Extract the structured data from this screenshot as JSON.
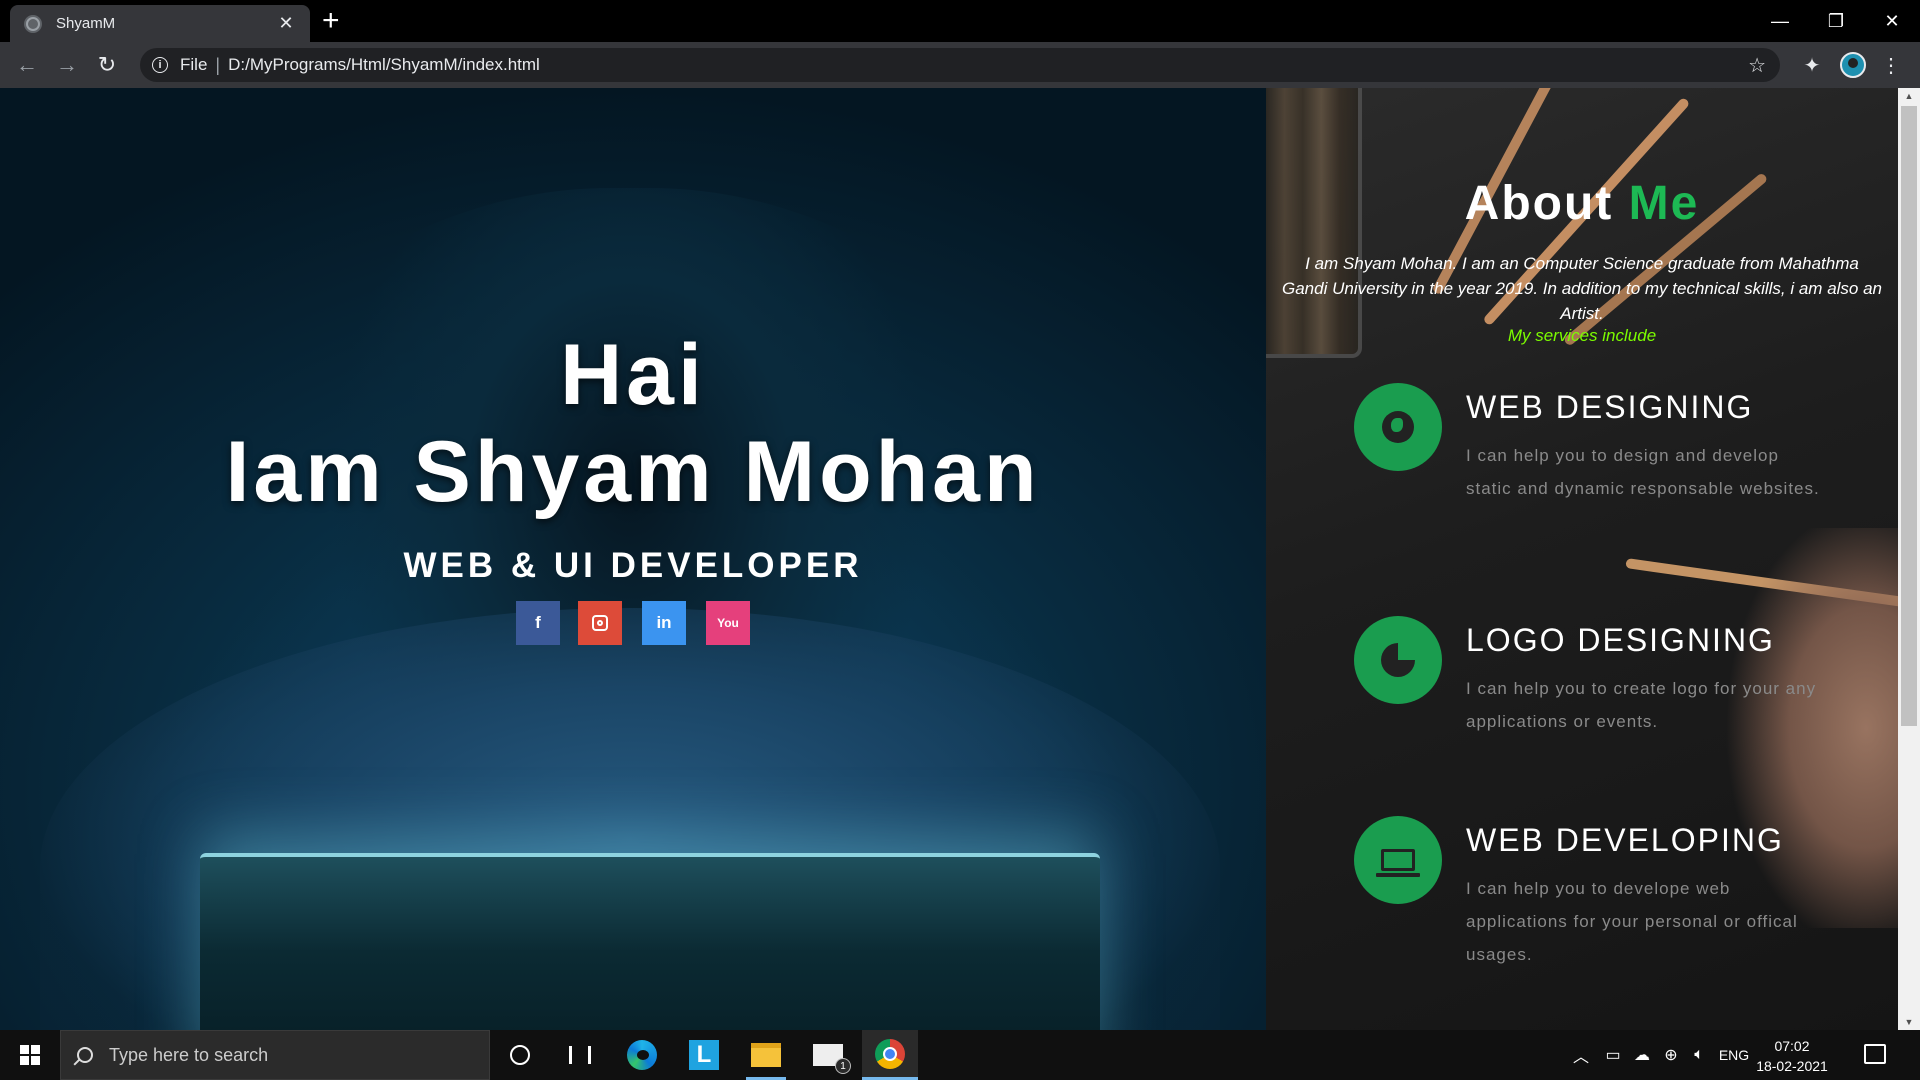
{
  "browser": {
    "tab_title": "ShyamM",
    "tab_close": "✕",
    "new_tab": "+",
    "scheme_label": "File",
    "url": "D:/MyPrograms/Html/ShyamM/index.html",
    "icons": [
      "back-icon",
      "forward-icon",
      "reload-icon",
      "info-icon",
      "star-icon",
      "extensions-icon",
      "profile-icon",
      "menu-icon"
    ]
  },
  "window_controls": {
    "minimize": "—",
    "restore": "❐",
    "close": "✕"
  },
  "hero": {
    "greeting": "Hai",
    "name": "Iam Shyam Mohan",
    "role": "WEB & UI DEVELOPER",
    "socials": [
      {
        "name": "facebook",
        "glyph": "f",
        "color": "#3b5998"
      },
      {
        "name": "instagram",
        "glyph": "",
        "color": "#dd4b39"
      },
      {
        "name": "linkedin",
        "glyph": "in",
        "color": "#3b94f0"
      },
      {
        "name": "youtube",
        "glyph": "You",
        "color": "#e5407c"
      }
    ]
  },
  "about": {
    "title_main": "About",
    "title_accent": "Me",
    "accent_color": "#1db954",
    "description": "I am Shyam Mohan. I am an Computer Science graduate from Mahathma Gandi University in the year 2019. In addition to my technical skills, i am also an Artist.",
    "services_intro": "My services include",
    "services": [
      {
        "title": "WEB DESIGNING",
        "desc": "I can help you to design and develop static and dynamic responsable websites.",
        "icon": "globe-icon"
      },
      {
        "title": "LOGO DESIGNING",
        "desc": "I can help you to create logo for your any applications or events.",
        "icon": "pie-chart-icon"
      },
      {
        "title": "WEB DEVELOPING",
        "desc": "I can help you to develope web applications for your personal or offical usages.",
        "icon": "laptop-icon"
      }
    ]
  },
  "taskbar": {
    "search_placeholder": "Type here to search",
    "mail_badge": "1",
    "language": "ENG",
    "time": "07:02",
    "date": "18-02-2021"
  }
}
